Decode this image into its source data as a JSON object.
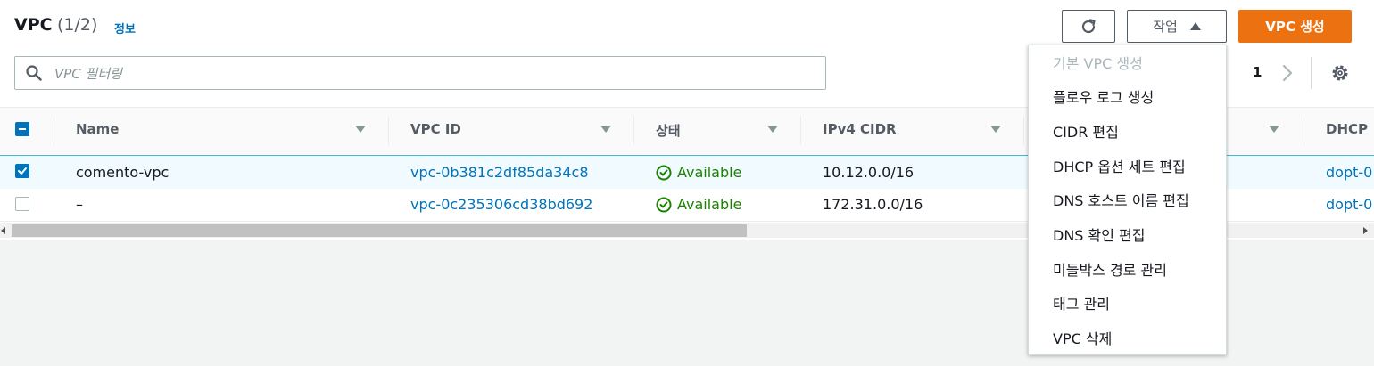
{
  "header": {
    "title": "VPC",
    "count": "(1/2)",
    "info_link": "정보"
  },
  "toolbar": {
    "actions_label": "작업",
    "create_label": "VPC 생성"
  },
  "search": {
    "placeholder": "VPC 필터링",
    "value": ""
  },
  "pagination": {
    "current_page": "1"
  },
  "table": {
    "columns": [
      "Name",
      "VPC ID",
      "상태",
      "IPv4 CIDR",
      "DHCP"
    ],
    "rows": [
      {
        "name": "comento-vpc",
        "vpc_id": "vpc-0b381c2df85da34c8",
        "status": "Available",
        "ipv4_cidr": "10.12.0.0/16",
        "dhcp": "dopt-0",
        "selected": true
      },
      {
        "name": "–",
        "vpc_id": "vpc-0c235306cd38bd692",
        "status": "Available",
        "ipv4_cidr": "172.31.0.0/16",
        "dhcp": "dopt-0",
        "selected": false
      }
    ]
  },
  "actions_menu": {
    "items": [
      {
        "label": "기본 VPC 생성",
        "disabled": true
      },
      {
        "label": "플로우 로그 생성",
        "disabled": false
      },
      {
        "label": "CIDR 편집",
        "disabled": false
      },
      {
        "label": "DHCP 옵션 세트 편집",
        "disabled": false
      },
      {
        "label": "DNS 호스트 이름 편집",
        "disabled": false
      },
      {
        "label": "DNS 확인 편집",
        "disabled": false
      },
      {
        "label": "미들박스 경로 관리",
        "disabled": false
      },
      {
        "label": "태그 관리",
        "disabled": false
      },
      {
        "label": "VPC 삭제",
        "disabled": false
      }
    ]
  },
  "colors": {
    "accent": "#0073bb",
    "primary_button": "#ec7211",
    "success": "#1d8102",
    "selected_row_bg": "#f1faff",
    "selected_row_border": "#44b9d6"
  }
}
